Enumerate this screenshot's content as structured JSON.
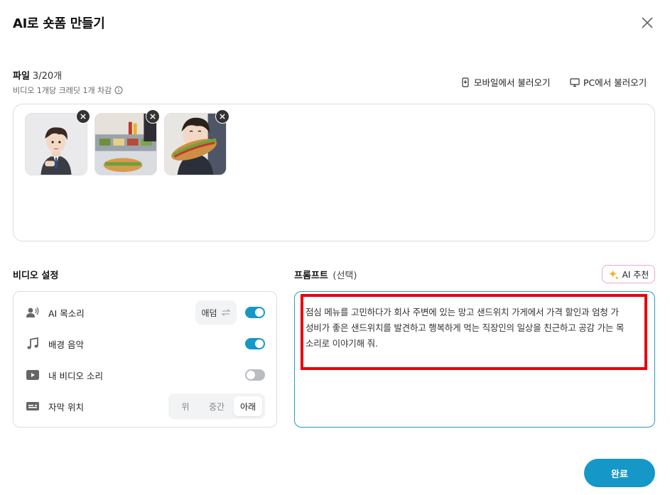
{
  "dialog": {
    "title": "AI로 숏폼 만들기"
  },
  "files": {
    "label": "파일",
    "count": "3/20개",
    "credit_note": "비디오 1개당 크레딧 1개 차감",
    "import_mobile": "모바일에서 불러오기",
    "import_pc": "PC에서 불러오기",
    "thumbnails": [
      {
        "icon": "office-worker-image"
      },
      {
        "icon": "sandwich-shop-image"
      },
      {
        "icon": "eating-sandwich-image"
      }
    ]
  },
  "video_settings": {
    "title": "비디오 설정",
    "ai_voice": {
      "label": "AI 목소리",
      "voice_name": "애덤",
      "enabled": true
    },
    "bgm": {
      "label": "배경 음악",
      "enabled": true
    },
    "my_audio": {
      "label": "내 비디오 소리",
      "enabled": false
    },
    "subtitle": {
      "label": "자막 위치",
      "options": [
        "위",
        "중간",
        "아래"
      ],
      "selected": "아래"
    }
  },
  "prompt": {
    "title": "프롬프트",
    "optional": "(선택)",
    "ai_recommend": "AI 추천",
    "text_line1": "점심 메뉴를 고민하다가 회사 주변에 있는 망고 샌드위치 가게에서 가격 할인과 엄청 가",
    "text_line2": "성비가 좋은 샌드위치를 발견하고 행복하게 먹는 직장인의 일상을 친근하고 공감 가는 목",
    "text_line3": "소리로 이야기해 줘."
  },
  "footer": {
    "done": "완료"
  },
  "colors": {
    "accent": "#1597c7",
    "highlight": "#e8000b",
    "ai_border": "#e5a9d6"
  }
}
